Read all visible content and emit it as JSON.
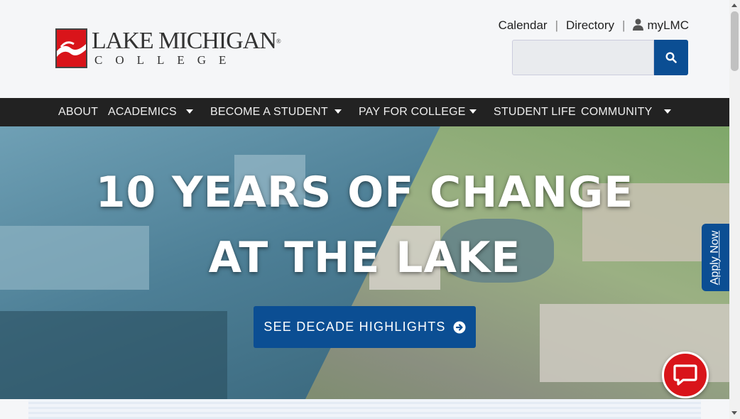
{
  "logo": {
    "line1": "LAKE MICHIGAN",
    "registered": "®",
    "line2": "COLLEGE"
  },
  "utility_links": {
    "calendar": "Calendar",
    "directory": "Directory",
    "mylmc": "myLMC",
    "separator": "|"
  },
  "search": {
    "placeholder": "",
    "icon": "search-icon"
  },
  "nav": {
    "items": [
      {
        "label": "ABOUT",
        "has_dropdown": false
      },
      {
        "label": "ACADEMICS",
        "has_dropdown": true
      },
      {
        "label": "BECOME A STUDENT",
        "has_dropdown": true
      },
      {
        "label": "PAY FOR COLLEGE",
        "has_dropdown": true
      },
      {
        "label": "STUDENT LIFE",
        "has_dropdown": false
      },
      {
        "label": "COMMUNITY",
        "has_dropdown": true
      }
    ]
  },
  "hero": {
    "title_line1": "10 YEARS OF CHANGE",
    "title_line2": "AT THE LAKE",
    "cta_label": "SEE DECADE HIGHLIGHTS"
  },
  "apply_tab": {
    "label": "Apply Now"
  },
  "colors": {
    "brand_blue": "#0b4e93",
    "brand_red": "#d9141a",
    "nav_bg": "#222222"
  }
}
